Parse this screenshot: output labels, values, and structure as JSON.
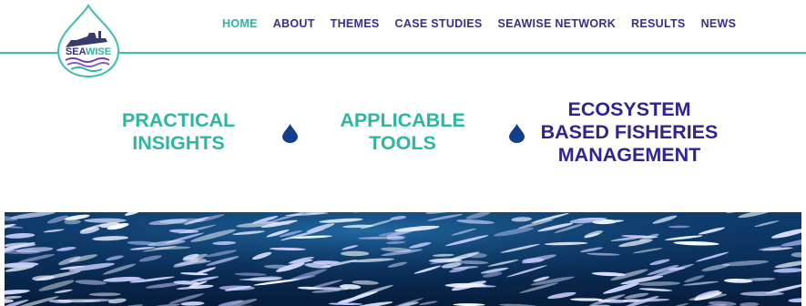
{
  "brand": {
    "logo_text": "SEAWISE",
    "logo_icon": "seawise-drop-logo"
  },
  "nav": {
    "items": [
      {
        "label": "HOME",
        "active": true
      },
      {
        "label": "ABOUT",
        "active": false
      },
      {
        "label": "THEMES",
        "active": false
      },
      {
        "label": "CASE STUDIES",
        "active": false
      },
      {
        "label": "SEAWISE NETWORK",
        "active": false
      },
      {
        "label": "RESULTS",
        "active": false
      },
      {
        "label": "NEWS",
        "active": false
      }
    ]
  },
  "taglines": [
    {
      "lines": [
        "PRACTICAL",
        "INSIGHTS"
      ]
    },
    {
      "lines": [
        "APPLICABLE",
        "TOOLS"
      ]
    },
    {
      "lines": [
        "ECOSYSTEM",
        "BASED FISHERIES",
        "MANAGEMENT"
      ]
    }
  ],
  "separator_icon": "water-drop-icon",
  "hero": {
    "image": "school-of-fish-photo"
  },
  "colors": {
    "teal": "#2bb89e",
    "navy": "#2f2490",
    "line": "#3cc0ac",
    "drop": "#143d8a"
  }
}
